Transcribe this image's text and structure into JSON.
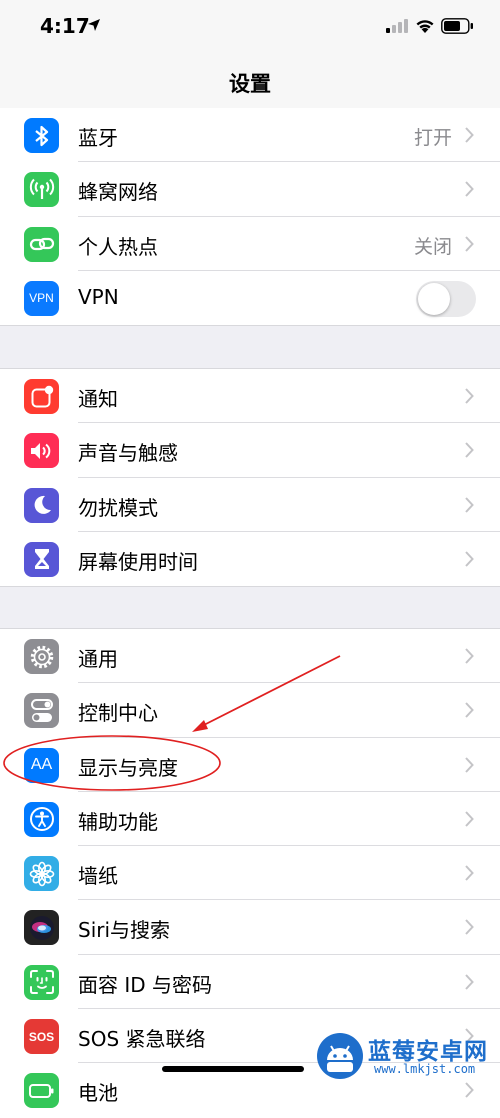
{
  "status_bar": {
    "time": "4:17"
  },
  "nav": {
    "title": "设置"
  },
  "group1": [
    {
      "label": "蓝牙",
      "value": "打开",
      "icon": "bluetooth-icon",
      "color": "#007aff"
    },
    {
      "label": "蜂窝网络",
      "value": "",
      "icon": "antenna-icon",
      "color": "#34c759"
    },
    {
      "label": "个人热点",
      "value": "关闭",
      "icon": "hotspot-icon",
      "color": "#34c759"
    },
    {
      "label": "VPN",
      "value": "",
      "icon": "vpn-icon",
      "icon_text": "VPN",
      "color": "#0a7aff",
      "toggle": false
    }
  ],
  "group2": [
    {
      "label": "通知",
      "icon": "notification-icon",
      "color": "#ff3b30"
    },
    {
      "label": "声音与触感",
      "icon": "speaker-icon",
      "color": "#ff2d55"
    },
    {
      "label": "勿扰模式",
      "icon": "moon-icon",
      "color": "#5856d6"
    },
    {
      "label": "屏幕使用时间",
      "icon": "hourglass-icon",
      "color": "#5856d6"
    }
  ],
  "group3": [
    {
      "label": "通用",
      "icon": "gear-icon",
      "color": "#8e8e93"
    },
    {
      "label": "控制中心",
      "icon": "switches-icon",
      "color": "#8e8e93"
    },
    {
      "label": "显示与亮度",
      "icon": "text-size-icon",
      "icon_text": "AA",
      "color": "#007aff"
    },
    {
      "label": "辅助功能",
      "icon": "accessibility-icon",
      "color": "#007aff"
    },
    {
      "label": "墙纸",
      "icon": "flower-icon",
      "color": "#32ade6"
    },
    {
      "label": "Siri与搜索",
      "icon": "siri-icon",
      "color": "#222222"
    },
    {
      "label": "面容 ID 与密码",
      "icon": "faceid-icon",
      "color": "#34c759"
    },
    {
      "label": "SOS 紧急联络",
      "icon": "sos-icon",
      "icon_text": "SOS",
      "color": "#e53935"
    },
    {
      "label": "电池",
      "icon": "battery-icon",
      "color": "#34c759"
    }
  ],
  "watermark": {
    "title": "蓝莓安卓网",
    "url": "www.lmkjst.com"
  },
  "colors": {
    "chevron": "#c4c4c7",
    "annotation": "#e02020",
    "watermark": "#1e6ecb"
  }
}
